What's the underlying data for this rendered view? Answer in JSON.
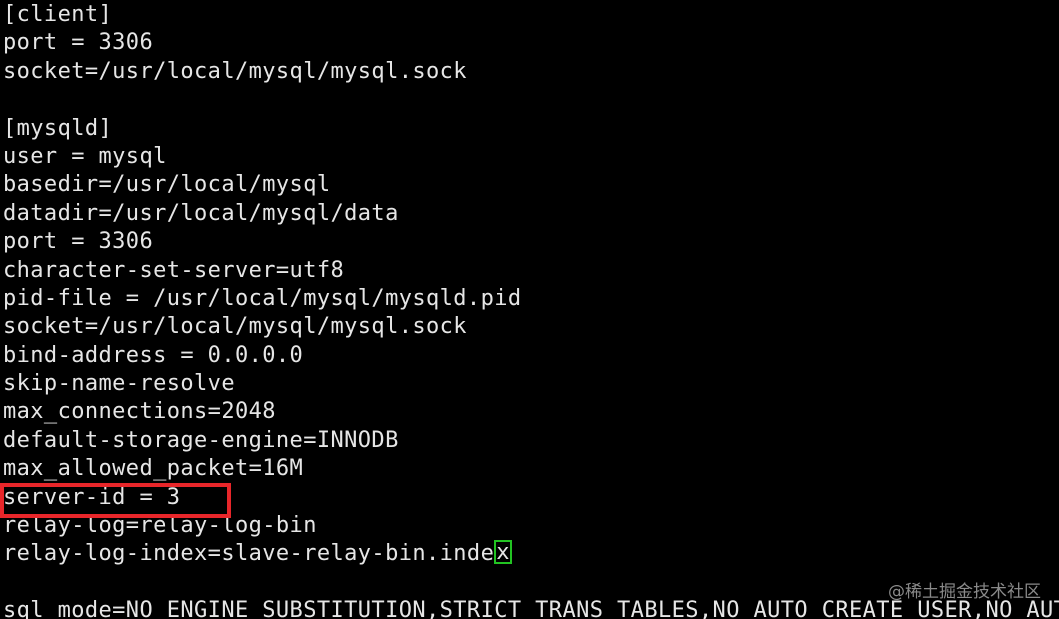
{
  "terminal": {
    "lines": [
      "[client]",
      "port = 3306",
      "socket=/usr/local/mysql/mysql.sock",
      "",
      "[mysqld]",
      "user = mysql",
      "basedir=/usr/local/mysql",
      "datadir=/usr/local/mysql/data",
      "port = 3306",
      "character-set-server=utf8",
      "pid-file = /usr/local/mysql/mysqld.pid",
      "socket=/usr/local/mysql/mysql.sock",
      "bind-address = 0.0.0.0",
      "skip-name-resolve",
      "max_connections=2048",
      "default-storage-engine=INNODB",
      "max_allowed_packet=16M",
      "server-id = 3",
      "relay-log=relay-log-bin",
      "relay-log-index=slave-relay-bin.inde",
      "",
      "sql_mode=NO_ENGINE_SUBSTITUTION,STRICT_TRANS_TABLES,NO_AUTO_CREATE_USER,NO_AUTO"
    ],
    "cursor_char": "x",
    "highlighted_line": "server-id = 3"
  },
  "colors": {
    "background": "#000000",
    "text": "#e6e6e6",
    "highlight_box": "#e8262a",
    "cursor": "#22c322"
  },
  "watermark": "@稀土掘金技术社区"
}
